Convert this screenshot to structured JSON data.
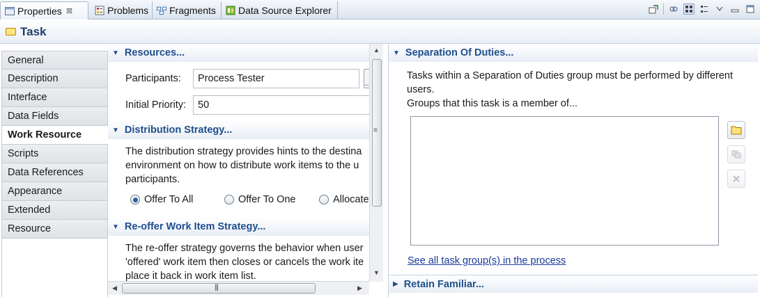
{
  "tabs": [
    {
      "label": "Properties",
      "close": "⊠",
      "icon": "properties-icon"
    },
    {
      "label": "Problems",
      "icon": "problems-icon"
    },
    {
      "label": "Fragments",
      "icon": "fragments-icon"
    },
    {
      "label": "Data Source Explorer",
      "icon": "data-source-explorer-icon"
    }
  ],
  "header": {
    "title": "Task"
  },
  "nav": {
    "items": [
      "General",
      "Description",
      "Interface",
      "Data Fields",
      "Work Resource",
      "Scripts",
      "Data References",
      "Appearance",
      "Extended",
      "Resource"
    ],
    "active": "Work Resource"
  },
  "resources": {
    "heading": "Resources...",
    "participants_label": "Participants:",
    "participants_value": "Process Tester",
    "participants_button": "...",
    "priority_label": "Initial Priority:",
    "priority_value": "50"
  },
  "distribution": {
    "heading": "Distribution Strategy...",
    "line1": "The distribution strategy provides hints to the destina",
    "line2": "environment on how to distribute work items to the u",
    "line3": "participants.",
    "options": [
      "Offer To All",
      "Offer To One",
      "Allocate"
    ],
    "selected": "Offer To All"
  },
  "reoffer": {
    "heading": "Re-offer Work Item Strategy...",
    "line1": "The re-offer strategy governs the behavior when user",
    "line2": "'offered' work item then closes or cancels the work ite",
    "line3": "place it back in work item list."
  },
  "separation": {
    "heading": "Separation Of Duties...",
    "line1": "Tasks within a Separation of Duties group must be performed by different",
    "line2": "users.",
    "line3": "Groups that this task is a member of...",
    "link": "See all task group(s) in the process"
  },
  "retain": {
    "heading": "Retain Familiar..."
  },
  "scroll": {
    "grip": "|||",
    "grip_v": "≡"
  }
}
